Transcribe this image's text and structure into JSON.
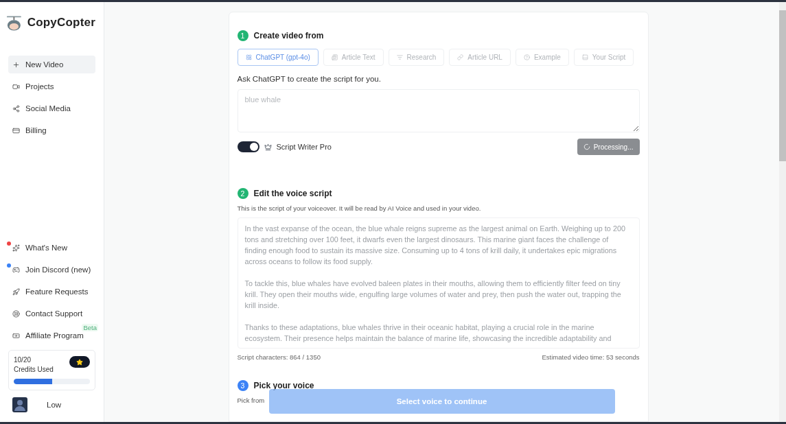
{
  "brand": {
    "name": "CopyCopter"
  },
  "sidebar": {
    "nav": [
      {
        "label": "New Video",
        "selected": true
      },
      {
        "label": "Projects",
        "selected": false
      },
      {
        "label": "Social Media",
        "selected": false
      },
      {
        "label": "Billing",
        "selected": false
      }
    ],
    "links": [
      {
        "label": "What's New",
        "color": "#ef4444"
      },
      {
        "label": "Join Discord (new)",
        "color": "#3b82f6"
      },
      {
        "label": "Feature Requests"
      },
      {
        "label": "Contact Support"
      },
      {
        "label": "Affiliate Program",
        "badge": "Beta"
      }
    ],
    "credits": {
      "count": "10/20",
      "label": "Credits Used",
      "level": 0.5
    },
    "user": {
      "name": "Low"
    }
  },
  "steps": [
    {
      "number": "1",
      "title": "Create video from",
      "color": "#22b573"
    },
    {
      "number": "2",
      "title": "Edit the voice script",
      "color": "#22b573"
    },
    {
      "number": "3",
      "title": "Pick your voice",
      "color": "#3b82f6"
    }
  ],
  "source_tabs": [
    {
      "label": "ChatGPT (gpt-4o)",
      "selected": true
    },
    {
      "label": "Article Text",
      "selected": false
    },
    {
      "label": "Research",
      "selected": false
    },
    {
      "label": "Article URL",
      "selected": false
    },
    {
      "label": "Example",
      "selected": false
    },
    {
      "label": "Your Script",
      "selected": false
    }
  ],
  "prompt": {
    "label": "Ask ChatGPT to create the script for you.",
    "placeholder": "blue whale"
  },
  "script_writer_pro": {
    "label": "Script Writer Pro",
    "on": true
  },
  "generate_button": {
    "label": "Processing...",
    "busy": true
  },
  "script": {
    "description": "This is the script of your voiceover. It will be read by AI Voice and used in your video.",
    "text": "In the vast expanse of the ocean, the blue whale reigns supreme as the largest animal on Earth. Weighing up to 200 tons and stretching over 100 feet, it dwarfs even the largest dinosaurs. This marine giant faces the challenge of finding enough food to sustain its massive size. Consuming up to 4 tons of krill daily, it undertakes epic migrations across oceans to follow its food supply.\n\nTo tackle this, blue whales have evolved baleen plates in their mouths, allowing them to efficiently filter feed on tiny krill. They open their mouths wide, engulfing large volumes of water and prey, then push the water out, trapping the krill inside.\n\nThanks to these adaptations, blue whales thrive in their oceanic habitat, playing a crucial role in the marine ecosystem. Their presence helps maintain the balance of marine life, showcasing the incredible adaptability and",
    "characters": "Script characters: 864 / 1350",
    "estimate": "Estimated video time: 53 seconds"
  },
  "voice": {
    "description": "Pick from"
  },
  "continue_button": {
    "label": "Select voice to continue"
  }
}
